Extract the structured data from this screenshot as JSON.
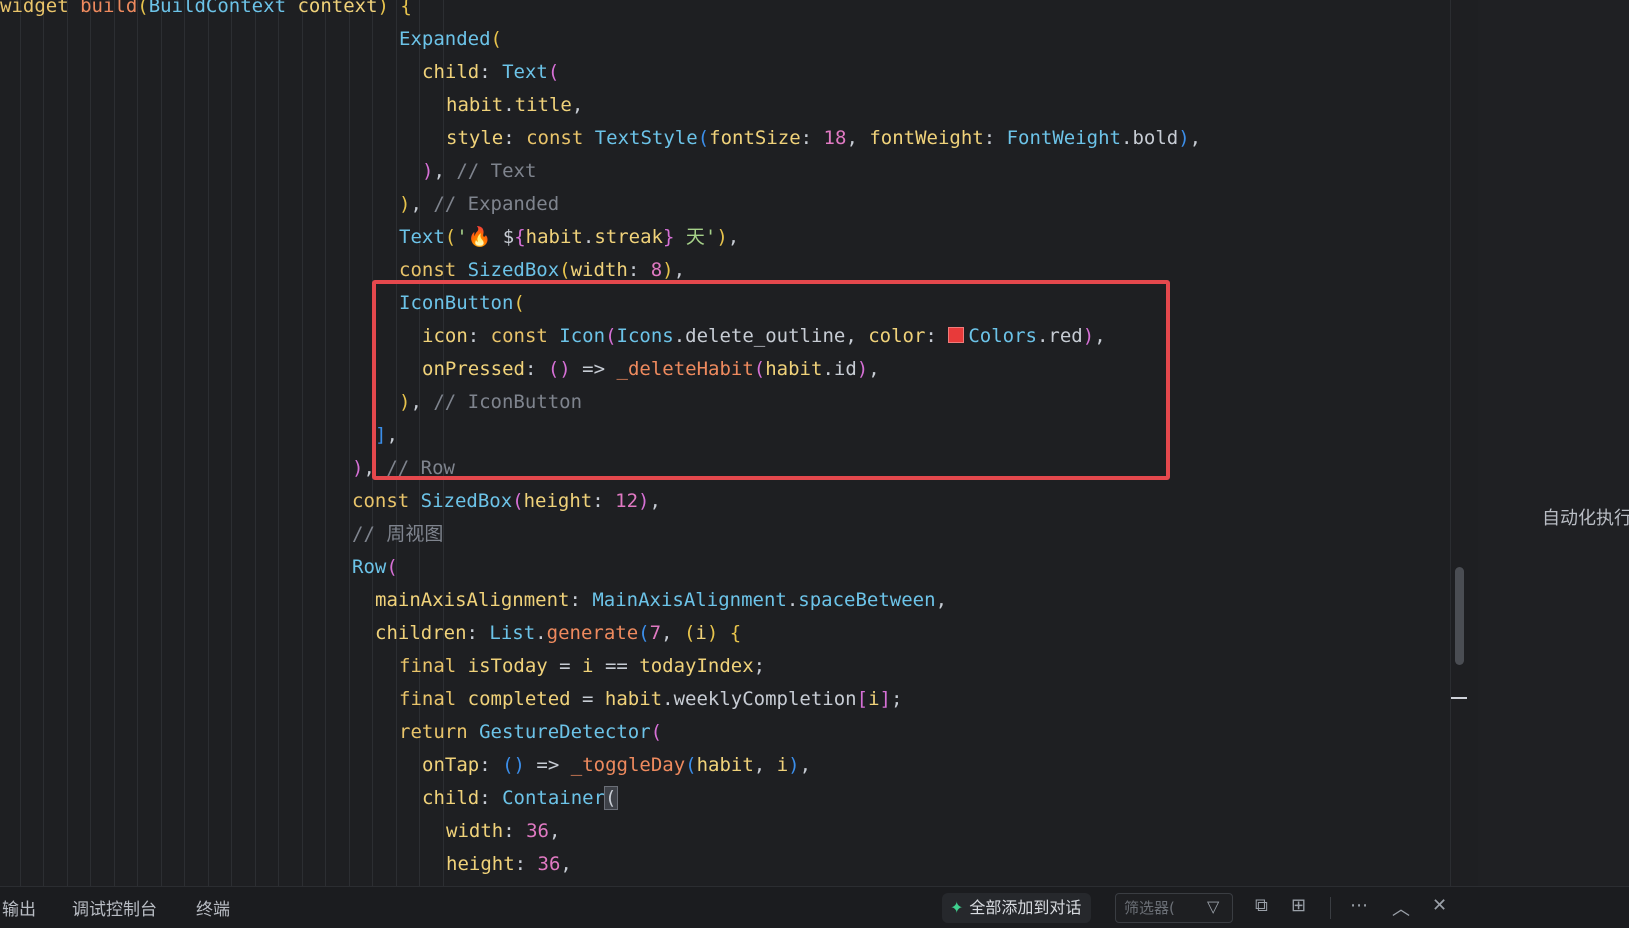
{
  "editor": {
    "lines": [
      [
        [
          "kw",
          "widget "
        ],
        [
          "fn",
          "build"
        ],
        [
          "p1",
          "("
        ],
        [
          "ty",
          "BuildContext "
        ],
        [
          "pr",
          "context"
        ],
        [
          "p1",
          ") {"
        ]
      ],
      [
        [
          "ty",
          "Expanded"
        ],
        [
          "p1",
          "("
        ]
      ],
      [
        [
          "pr",
          "child"
        ],
        [
          "pl",
          ": "
        ],
        [
          "ty",
          "Text"
        ],
        [
          "p2",
          "("
        ]
      ],
      [
        [
          "pr",
          "habit"
        ],
        [
          "pl",
          "."
        ],
        [
          "pr",
          "title"
        ],
        [
          "pl",
          ","
        ]
      ],
      [
        [
          "pr",
          "style"
        ],
        [
          "pl",
          ": "
        ],
        [
          "kw",
          "const "
        ],
        [
          "ty",
          "TextStyle"
        ],
        [
          "p3",
          "("
        ],
        [
          "pr",
          "fontSize"
        ],
        [
          "pl",
          ": "
        ],
        [
          "num",
          "18"
        ],
        [
          "pl",
          ", "
        ],
        [
          "pr",
          "fontWeight"
        ],
        [
          "pl",
          ": "
        ],
        [
          "ty",
          "FontWeight"
        ],
        [
          "pl",
          "."
        ],
        [
          "pl",
          "bold"
        ],
        [
          "p3",
          ")"
        ],
        [
          "pl",
          ","
        ]
      ],
      [
        [
          "p2",
          ")"
        ],
        [
          "pl",
          ", "
        ],
        [
          "cm",
          "// Text"
        ]
      ],
      [
        [
          "p1",
          ")"
        ],
        [
          "pl",
          ", "
        ],
        [
          "cm",
          "// Expanded"
        ]
      ],
      [
        [
          "ty",
          "Text"
        ],
        [
          "p1",
          "("
        ],
        [
          "str",
          "'🔥 "
        ],
        [
          "pl",
          "$"
        ],
        [
          "p2",
          "{"
        ],
        [
          "pr",
          "habit"
        ],
        [
          "pl",
          "."
        ],
        [
          "pr",
          "streak"
        ],
        [
          "p2",
          "}"
        ],
        [
          "str",
          " 天'"
        ],
        [
          "p1",
          ")"
        ],
        [
          "pl",
          ","
        ]
      ],
      [
        [
          "kw",
          "const "
        ],
        [
          "ty",
          "SizedBox"
        ],
        [
          "p1",
          "("
        ],
        [
          "pr",
          "width"
        ],
        [
          "pl",
          ": "
        ],
        [
          "num",
          "8"
        ],
        [
          "p1",
          ")"
        ],
        [
          "pl",
          ","
        ]
      ],
      [
        [
          "ty",
          "IconButton"
        ],
        [
          "p1",
          "("
        ]
      ],
      [
        [
          "pr",
          "icon"
        ],
        [
          "pl",
          ": "
        ],
        [
          "kw",
          "const "
        ],
        [
          "ty",
          "Icon"
        ],
        [
          "p2",
          "("
        ],
        [
          "ty",
          "Icons"
        ],
        [
          "pl",
          "."
        ],
        [
          "pl",
          "delete_outline"
        ],
        [
          "pl",
          ", "
        ],
        [
          "pr",
          "color"
        ],
        [
          "pl",
          ": "
        ],
        [
          "swatch",
          ""
        ],
        [
          "ty",
          "Colors"
        ],
        [
          "pl",
          "."
        ],
        [
          "pl",
          "red"
        ],
        [
          "p2",
          ")"
        ],
        [
          "pl",
          ","
        ]
      ],
      [
        [
          "pr",
          "onPressed"
        ],
        [
          "pl",
          ": "
        ],
        [
          "p2",
          "() "
        ],
        [
          "pl",
          "=> "
        ],
        [
          "fn",
          "_deleteHabit"
        ],
        [
          "p2",
          "("
        ],
        [
          "pr",
          "habit"
        ],
        [
          "pl",
          "."
        ],
        [
          "pl",
          "id"
        ],
        [
          "p2",
          ")"
        ],
        [
          "pl",
          ","
        ]
      ],
      [
        [
          "p1",
          ")"
        ],
        [
          "pl",
          ", "
        ],
        [
          "cm",
          "// IconButton"
        ]
      ],
      [
        [
          "p3",
          "]"
        ],
        [
          "pl",
          ","
        ]
      ],
      [
        [
          "p2",
          ")"
        ],
        [
          "pl",
          ", "
        ],
        [
          "cm",
          "// Row"
        ]
      ],
      [
        [
          "kw",
          "const "
        ],
        [
          "ty",
          "SizedBox"
        ],
        [
          "p2",
          "("
        ],
        [
          "pr",
          "height"
        ],
        [
          "pl",
          ": "
        ],
        [
          "num",
          "12"
        ],
        [
          "p2",
          ")"
        ],
        [
          "pl",
          ","
        ]
      ],
      [
        [
          "cm",
          "// 周视图"
        ]
      ],
      [
        [
          "ty",
          "Row"
        ],
        [
          "p2",
          "("
        ]
      ],
      [
        [
          "pr",
          "mainAxisAlignment"
        ],
        [
          "pl",
          ": "
        ],
        [
          "ty",
          "MainAxisAlignment"
        ],
        [
          "pl",
          "."
        ],
        [
          "ty",
          "spaceBetween"
        ],
        [
          "pl",
          ","
        ]
      ],
      [
        [
          "pr",
          "children"
        ],
        [
          "pl",
          ": "
        ],
        [
          "ty",
          "List"
        ],
        [
          "pl",
          "."
        ],
        [
          "fn",
          "generate"
        ],
        [
          "p3",
          "("
        ],
        [
          "num",
          "7"
        ],
        [
          "pl",
          ", "
        ],
        [
          "p1",
          "("
        ],
        [
          "pr",
          "i"
        ],
        [
          "p1",
          ") {"
        ]
      ],
      [
        [
          "kw",
          "final "
        ],
        [
          "pr",
          "isToday"
        ],
        [
          "pl",
          " = "
        ],
        [
          "pr",
          "i"
        ],
        [
          "pl",
          " == "
        ],
        [
          "pr",
          "todayIndex"
        ],
        [
          "pl",
          ";"
        ]
      ],
      [
        [
          "kw",
          "final "
        ],
        [
          "pr",
          "completed"
        ],
        [
          "pl",
          " = "
        ],
        [
          "pr",
          "habit"
        ],
        [
          "pl",
          "."
        ],
        [
          "pl",
          "weeklyCompletion"
        ],
        [
          "p2",
          "["
        ],
        [
          "pr",
          "i"
        ],
        [
          "p2",
          "]"
        ],
        [
          "pl",
          ";"
        ]
      ],
      [
        [
          "kw",
          "return "
        ],
        [
          "ty",
          "GestureDetector"
        ],
        [
          "p2",
          "("
        ]
      ],
      [
        [
          "pr",
          "onTap"
        ],
        [
          "pl",
          ": "
        ],
        [
          "p3",
          "() "
        ],
        [
          "pl",
          "=> "
        ],
        [
          "fn",
          "_toggleDay"
        ],
        [
          "p3",
          "("
        ],
        [
          "pr",
          "habit"
        ],
        [
          "pl",
          ", "
        ],
        [
          "pr",
          "i"
        ],
        [
          "p3",
          ")"
        ],
        [
          "pl",
          ","
        ]
      ],
      [
        [
          "pr",
          "child"
        ],
        [
          "pl",
          ": "
        ],
        [
          "ty",
          "Container"
        ],
        [
          "caret",
          "("
        ]
      ],
      [
        [
          "pr",
          "width"
        ],
        [
          "pl",
          ": "
        ],
        [
          "num",
          "36"
        ],
        [
          "pl",
          ","
        ]
      ],
      [
        [
          "pr",
          "height"
        ],
        [
          "pl",
          ": "
        ],
        [
          "num",
          "36"
        ],
        [
          "pl",
          ","
        ]
      ]
    ]
  },
  "right_panel": {
    "label": "自动化执行"
  },
  "bottom_bar": {
    "tabs": [
      "输出",
      "调试控制台",
      "终端"
    ],
    "add_all_label": "全部添加到对话",
    "filter_placeholder": "筛选器(",
    "icons": [
      "filter-icon",
      "copy-icon",
      "layout-icon",
      "more-icon",
      "chevron-up-icon",
      "close-icon"
    ]
  },
  "colors": {
    "highlight": "#e5484d",
    "accent": "#3fcf8e"
  }
}
